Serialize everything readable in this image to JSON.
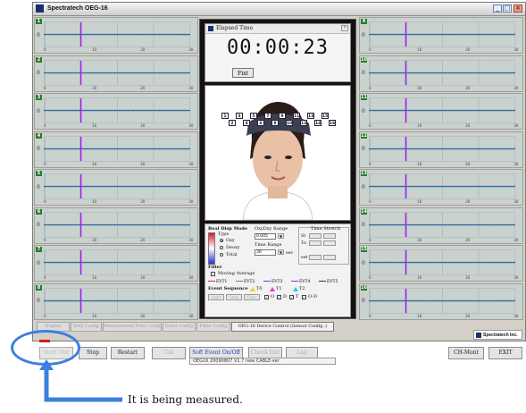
{
  "window": {
    "title": "Spectratech OEG-16",
    "controls": [
      "_",
      "□",
      "×"
    ]
  },
  "left_panels": [
    {
      "index": "1",
      "zero": "0",
      "ticks": [
        "0",
        "10",
        "20",
        "30"
      ]
    },
    {
      "index": "2",
      "zero": "0",
      "ticks": [
        "0",
        "10",
        "20",
        "30"
      ]
    },
    {
      "index": "3",
      "zero": "0",
      "ticks": [
        "0",
        "10",
        "20",
        "30"
      ]
    },
    {
      "index": "4",
      "zero": "0",
      "ticks": [
        "0",
        "10",
        "20",
        "30"
      ]
    },
    {
      "index": "5",
      "zero": "0",
      "ticks": [
        "0",
        "10",
        "20",
        "30"
      ]
    },
    {
      "index": "6",
      "zero": "0",
      "ticks": [
        "0",
        "10",
        "20",
        "30"
      ]
    },
    {
      "index": "7",
      "zero": "0",
      "ticks": [
        "0",
        "10",
        "20",
        "30"
      ]
    },
    {
      "index": "8",
      "zero": "0",
      "ticks": [
        "0",
        "10",
        "20",
        "30"
      ]
    }
  ],
  "right_panels": [
    {
      "index": "9",
      "zero": "0",
      "ticks": [
        "0",
        "10",
        "20",
        "30"
      ]
    },
    {
      "index": "10",
      "zero": "0",
      "ticks": [
        "0",
        "10",
        "20",
        "30"
      ]
    },
    {
      "index": "11",
      "zero": "0",
      "ticks": [
        "0",
        "10",
        "20",
        "30"
      ]
    },
    {
      "index": "12",
      "zero": "0",
      "ticks": [
        "0",
        "10",
        "20",
        "30"
      ]
    },
    {
      "index": "13",
      "zero": "0",
      "ticks": [
        "0",
        "10",
        "20",
        "30"
      ]
    },
    {
      "index": "14",
      "zero": "0",
      "ticks": [
        "0",
        "10",
        "20",
        "30"
      ]
    },
    {
      "index": "15",
      "zero": "0",
      "ticks": [
        "0",
        "10",
        "20",
        "30"
      ]
    },
    {
      "index": "16",
      "zero": "0",
      "ticks": [
        "0",
        "10",
        "20",
        "30"
      ]
    }
  ],
  "timer": {
    "title": "Elapsed Time",
    "time": "00:00:23",
    "fix_label": "Fixt"
  },
  "probes": [
    "1",
    "2",
    "3",
    "4",
    "5",
    "6",
    "7",
    "8",
    "9",
    "10",
    "11",
    "12",
    "13",
    "14",
    "15",
    "16"
  ],
  "controls": {
    "real_disp_mode": "Real Disp Mode",
    "type_label": "Type",
    "type_options": [
      "Oxy",
      "Deoxy",
      "Total"
    ],
    "type_selected": "Oxy",
    "oxy_range_label": "OxyDxy Range",
    "oxy_range_value": "0.005",
    "time_range_label": "Time Range",
    "time_range_value": "30",
    "time_range_unit": "sec",
    "time_stretch_label": "Time Stretch",
    "stretch_labels": [
      "St",
      "To"
    ],
    "set_label": "set",
    "filter_label": "Filter",
    "moving_average_label": "Moving Average",
    "evt_labels": [
      "EVT1",
      "EVT2",
      "EVT3",
      "EVT4",
      "EVT5"
    ],
    "event_sequence_label": "Event Sequence",
    "sequence_marks": [
      "T0",
      "T1",
      "T2"
    ],
    "bottom_buttons": [
      "Load",
      "Save",
      "Clear"
    ],
    "check_labels": [
      "O",
      "D",
      "T",
      "O-D"
    ]
  },
  "tabs": [
    "Display",
    "DAQ Config",
    "Measurement Point Config",
    "Event Config",
    "Filter Config",
    "OEG-16 Device Control (Sensor Config..)"
  ],
  "brand": "Spectratech Inc.",
  "buttons": {
    "start_measure": "Start Msr",
    "stop": "Stop",
    "restart": "Restart",
    "cal": "Cal",
    "soft_event": "Soft Event On/Off",
    "check_list": "Check List",
    "log": "Log",
    "ch_monitor": "CH-Mont",
    "exit": "EXIT"
  },
  "status_text": "OEG16 20090807 V1.7 new CABLE-ver",
  "annotation": {
    "caption": "It is being measured."
  },
  "colors": {
    "marker": "#a020f0",
    "annotation": "#3c7fe0",
    "redbar": "#d91b1b",
    "trace_blue": "#2f5ed8",
    "trace_green": "#3a9d3a",
    "trace_red": "#c43232"
  }
}
